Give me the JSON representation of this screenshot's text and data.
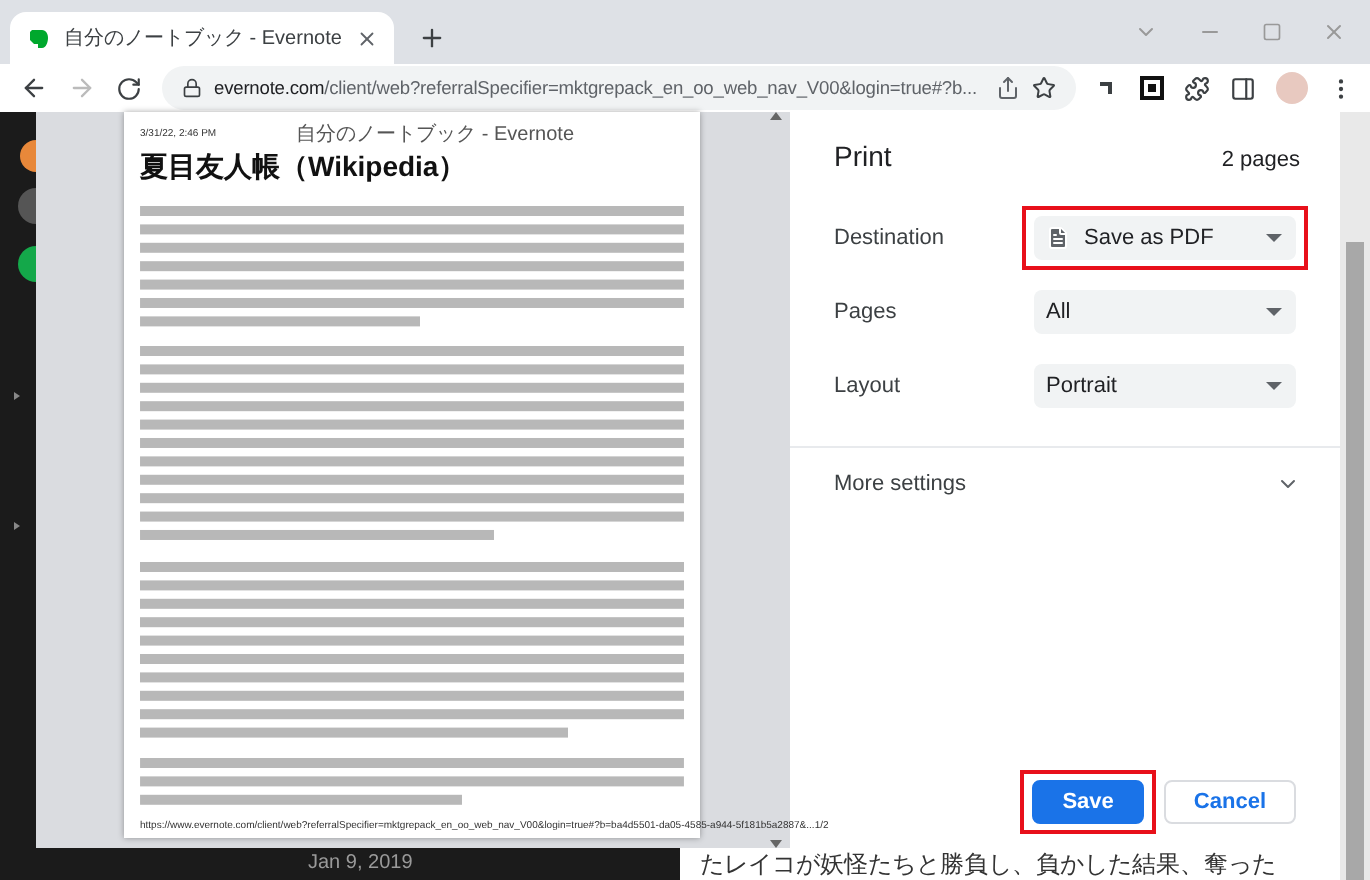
{
  "browser": {
    "tab": {
      "title": "自分のノートブック - Evernote"
    },
    "url": {
      "host": "evernote.com",
      "path": "/client/web?referralSpecifier=mktgrepack_en_oo_web_nav_V00&login=true#?b..."
    }
  },
  "preview": {
    "date": "3/31/22, 2:46 PM",
    "header": "自分のノートブック - Evernote",
    "title": "夏目友人帳（Wikipedia）",
    "footer_url": "https://www.evernote.com/client/web?referralSpecifier=mktgrepack_en_oo_web_nav_V00&login=true#?b=ba4d5501-da05-4585-a944-5f181b5a2887&...",
    "page_number": "1/2"
  },
  "print": {
    "title": "Print",
    "page_count": "2 pages",
    "settings": [
      {
        "label": "Destination",
        "value": "Save as PDF",
        "kind": "destination",
        "highlighted": true
      },
      {
        "label": "Pages",
        "value": "All",
        "kind": "select",
        "highlighted": false
      },
      {
        "label": "Layout",
        "value": "Portrait",
        "kind": "select",
        "highlighted": false
      }
    ],
    "more_settings": {
      "label": "More settings",
      "expanded": false
    },
    "buttons": [
      {
        "label": "Save",
        "kind": "primary",
        "highlighted": true
      },
      {
        "label": "Cancel",
        "kind": "secondary",
        "highlighted": false
      }
    ]
  },
  "background": {
    "date": "Jan 9, 2019",
    "text": "たレイコが妖怪たちと勝負し、負かした結果、奪った"
  }
}
